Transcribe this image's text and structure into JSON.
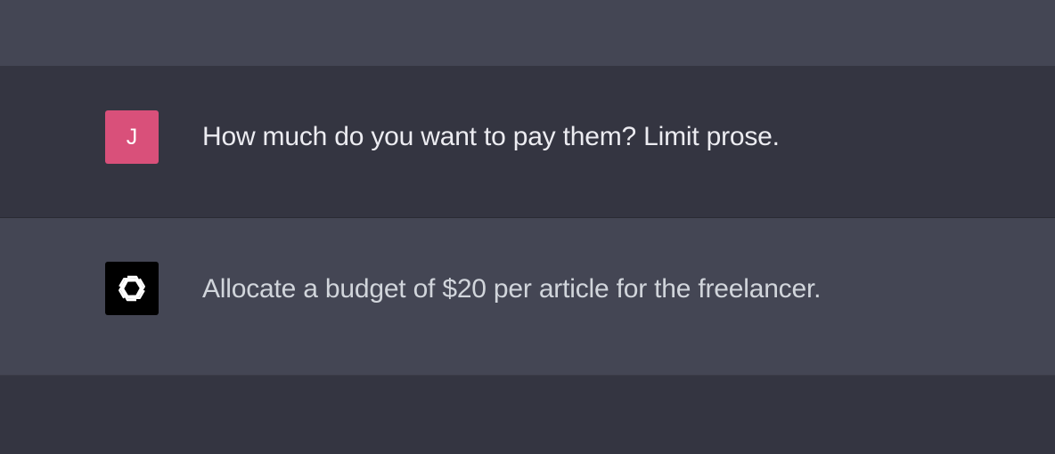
{
  "conversation": {
    "messages": [
      {
        "role": "user",
        "avatar_initial": "J",
        "avatar_color": "#d9507a",
        "text": "How much do you want to pay them? Limit prose."
      },
      {
        "role": "assistant",
        "avatar_icon": "openai-logo-icon",
        "avatar_color": "#000000",
        "text": "Allocate a budget of $20 per article for the freelancer."
      }
    ]
  },
  "colors": {
    "background_dark": "#343541",
    "background_light": "#444654",
    "user_text": "#ececf1",
    "assistant_text": "#d1d5db"
  }
}
